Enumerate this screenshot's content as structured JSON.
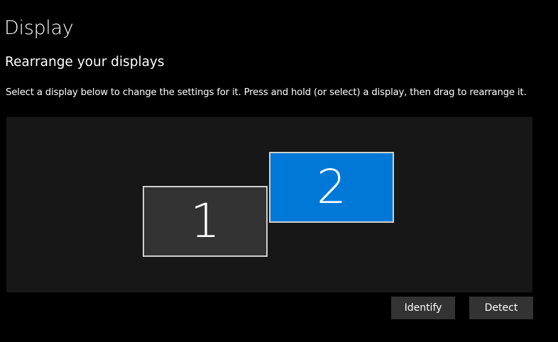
{
  "page": {
    "title": "Display"
  },
  "section": {
    "title": "Rearrange your displays",
    "description": "Select a display below to change the settings for it. Press and hold (or select) a display, then drag to rearrange it."
  },
  "displays": [
    {
      "label": "1",
      "selected": false
    },
    {
      "label": "2",
      "selected": true
    }
  ],
  "buttons": {
    "identify_label": "Identify",
    "detect_label": "Detect"
  },
  "colors": {
    "background": "#000000",
    "arrangement_area": "#171717",
    "display_unselected": "#333333",
    "display_selected_accent": "#0078d7",
    "button_bg": "#333333",
    "text": "#ffffff"
  }
}
